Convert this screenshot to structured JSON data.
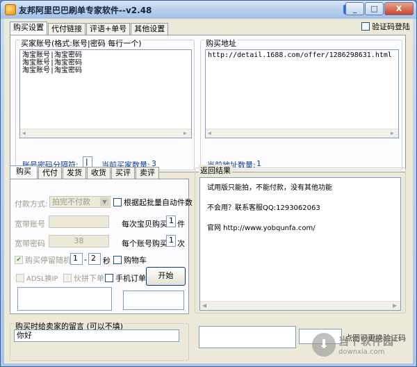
{
  "window": {
    "title": "友邦阿里巴巴刷单专家软件--v2.48",
    "min": "_",
    "max": "□",
    "close": "X"
  },
  "top_tabs": [
    "购买设置",
    "代付链接",
    "评语+单号",
    "其他设置"
  ],
  "verify_login_label": "验证码登陆",
  "buyer_accounts": {
    "label": "买家账号(格式:账号|密码 每行一个)",
    "lines": [
      "淘宝账号|淘宝密码",
      "淘宝账号|淘宝密码",
      "淘宝账号|淘宝密码"
    ],
    "separator_label": "账号密码分隔符:",
    "separator_value": "|",
    "count_label": "当前买家数量:",
    "count_value": "3"
  },
  "buy_address": {
    "label": "购买地址",
    "lines": [
      "http://detail.1688.com/offer/1286298631.html"
    ],
    "count_label": "当前地址数量:",
    "count_value": "1"
  },
  "bottom_tabs": [
    "购买",
    "代付",
    "发货",
    "收货",
    "买评",
    "卖评"
  ],
  "buy_panel": {
    "payment_method_label": "付款方式:",
    "payment_method_value": "拍完不付款",
    "auto_qty_label": "根据起批量自动件数",
    "broadband_account_label": "宽带账号",
    "broadband_password_label": "宽带密码",
    "broadband_password_value": "38",
    "per_item_label": "每次宝贝购买",
    "per_item_value": "1",
    "per_item_unit": "件",
    "per_account_label": "每个账号购买",
    "per_account_value": "1",
    "per_account_unit": "次",
    "random_wait_label": "购买停留随机",
    "random_min": "1",
    "random_dash": "-",
    "random_max": "2",
    "random_unit": "秒",
    "cart_label": "购物车",
    "adsl_label": "ADSL换IP",
    "pair_label": "伙拼下单",
    "mobile_label": "手机订单",
    "start_button": "开始"
  },
  "results": {
    "label": "返回结果",
    "lines": [
      "试用版只能拍，不能付款，没有其他功能",
      "不会用？联系客服QQ:1293062063",
      "官网 http://www.yobqunfa.com/"
    ]
  },
  "message": {
    "label": "购买时给卖家的留言 (可以不填)",
    "value": "你好"
  },
  "captcha_hint": "点图可更换验证码",
  "watermark": {
    "cn": "当下软件园",
    "en": "downxia.com"
  }
}
